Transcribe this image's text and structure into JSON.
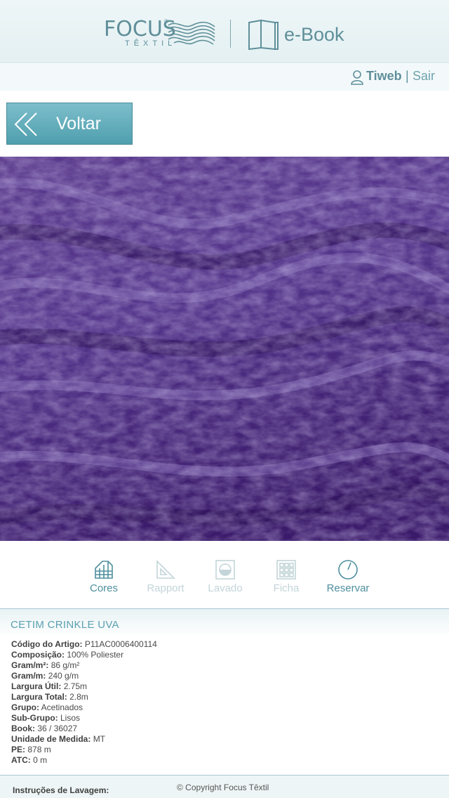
{
  "header": {
    "brand": "FOCUS",
    "brand_reg": "®",
    "brand_sub": "TÊXTIL",
    "app_label": "e-Book"
  },
  "user": {
    "name": "Tiweb",
    "separator": "|",
    "logout_label": "Sair"
  },
  "back_button": {
    "label": "Voltar"
  },
  "toolbar": {
    "items": [
      {
        "label": "Cores",
        "icon": "palette-grid-icon",
        "state": "active"
      },
      {
        "label": "Rapport",
        "icon": "set-square-icon",
        "state": "disabled"
      },
      {
        "label": "Lavado",
        "icon": "washing-icon",
        "state": "disabled"
      },
      {
        "label": "Ficha",
        "icon": "grid-sheet-icon",
        "state": "disabled"
      },
      {
        "label": "Reservar",
        "icon": "clock-icon",
        "state": "active"
      }
    ]
  },
  "product": {
    "title": "CETIM CRINKLE UVA",
    "specs": [
      {
        "key": "Código do Artigo:",
        "value": "P11AC0006400114"
      },
      {
        "key": "Composição:",
        "value": "100% Poliester"
      },
      {
        "key": "Gram/m²:",
        "value": "86 g/m²"
      },
      {
        "key": "Gram/m:",
        "value": "240 g/m"
      },
      {
        "key": "Largura Útil:",
        "value": "2.75m"
      },
      {
        "key": "Largura Total:",
        "value": "2.8m"
      },
      {
        "key": "Grupo:",
        "value": "Acetinados"
      },
      {
        "key": "Sub-Grupo:",
        "value": "Lisos"
      },
      {
        "key": "Book:",
        "value": "36 / 36027"
      },
      {
        "key": "Unidade de Medida:",
        "value": "MT"
      },
      {
        "key": "PE:",
        "value": "878 m"
      },
      {
        "key": "ATC:",
        "value": "0 m"
      }
    ]
  },
  "footer": {
    "wash_label": "Instruções de Lavagem:",
    "copyright": "© Copyright Focus Têxtil"
  },
  "colors": {
    "accent": "#5f8f9a",
    "button": "#5fabb9",
    "fabric": "#4a2a7a"
  }
}
